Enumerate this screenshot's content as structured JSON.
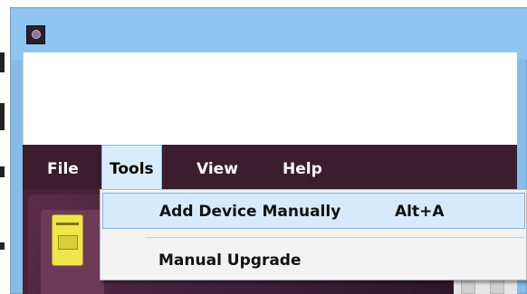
{
  "window": {
    "title_icon": "app-icon"
  },
  "menubar": {
    "items": [
      {
        "label": "File"
      },
      {
        "label": "Tools"
      },
      {
        "label": "View"
      },
      {
        "label": "Help"
      }
    ],
    "active_item": "Tools"
  },
  "dropdown": {
    "items": [
      {
        "label": "Add Device Manually",
        "shortcut": "Alt+A",
        "highlighted": true
      },
      {
        "label": "Manual Upgrade",
        "shortcut": "",
        "highlighted": false
      }
    ]
  },
  "colors": {
    "titlebar": "#8ec5f1",
    "menubar": "#3b1d2e",
    "menu_highlight": "#d6eafb",
    "device_thumb": "#f0e54a"
  }
}
